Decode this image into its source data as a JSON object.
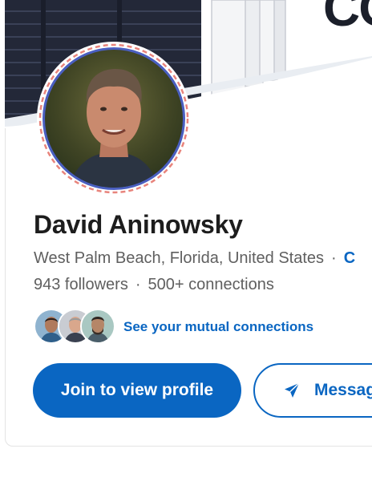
{
  "banner": {
    "logo_text": "CO",
    "colors": {
      "panel_dark": "#1f2433",
      "slat": "#2a3044",
      "binder": "#f2f3f5",
      "logo": "#1b1f2a"
    }
  },
  "profile": {
    "name": "David Aninowsky",
    "location": "West Palm Beach, Florida, United States",
    "separator": "·",
    "contact_link": "C",
    "followers": "943 followers",
    "connections": "500+ connections",
    "photo_icon": "profile-photo"
  },
  "mutuals": {
    "link_text": "See your mutual connections",
    "avatars": [
      "mutual-avatar-1",
      "mutual-avatar-2",
      "mutual-avatar-3"
    ]
  },
  "actions": {
    "join_label": "Join to view profile",
    "message_label": "Messag",
    "message_icon": "send-icon"
  },
  "colors": {
    "accent": "#0a66c2",
    "text_primary": "#1d1d1d",
    "text_secondary": "#5f5f5f",
    "ring_blue": "#4a5fc1",
    "ring_red": "#e8847c"
  }
}
